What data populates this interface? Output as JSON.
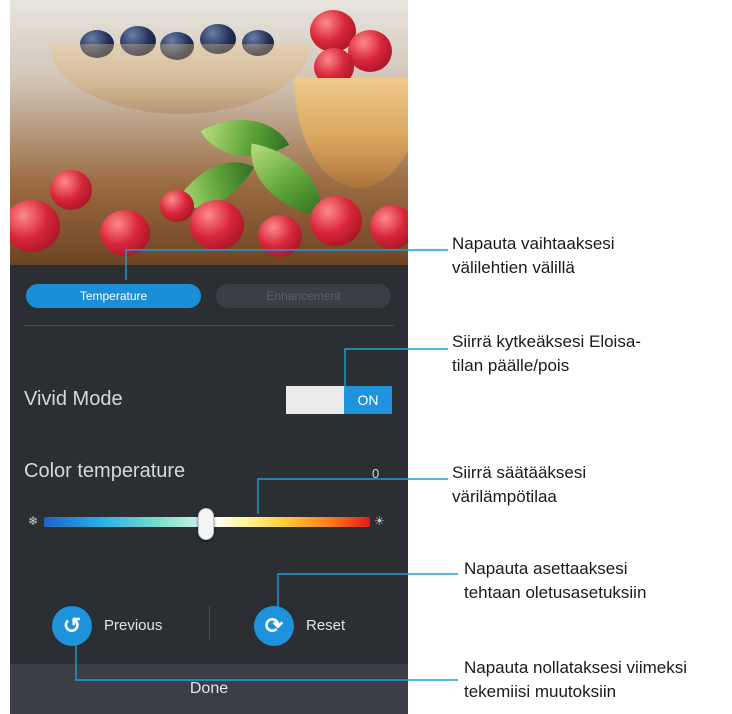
{
  "tabs": [
    {
      "label": "Temperature",
      "active": true
    },
    {
      "label": "Enhancement",
      "active": false
    }
  ],
  "vivid_mode": {
    "label": "Vivid Mode",
    "toggle_label": "ON",
    "state": "on"
  },
  "color_temperature": {
    "label": "Color temperature",
    "value": "0",
    "slider_fraction": 0.5
  },
  "actions": {
    "previous_label": "Previous",
    "reset_label": "Reset"
  },
  "done_label": "Done",
  "annotations": {
    "tabs_line1": "Napauta vaihtaaksesi",
    "tabs_line2": "välilehtien välillä",
    "vivid_line1": "Siirrä kytkeäksesi Eloisa-",
    "vivid_line2": "tilan päälle/pois",
    "slider_line1": "Siirrä säätääksesi",
    "slider_line2": "värilämpötilaa",
    "reset_line1": "Napauta asettaaksesi",
    "reset_line2": "tehtaan oletusasetuksiin",
    "previous_line1": "Napauta nollataksesi viimeksi",
    "previous_line2": "tekemiisi muutoksiin"
  },
  "colors": {
    "accent": "#1f92dc",
    "panel": "#2b2e33",
    "done_bar": "#3b3f45"
  }
}
